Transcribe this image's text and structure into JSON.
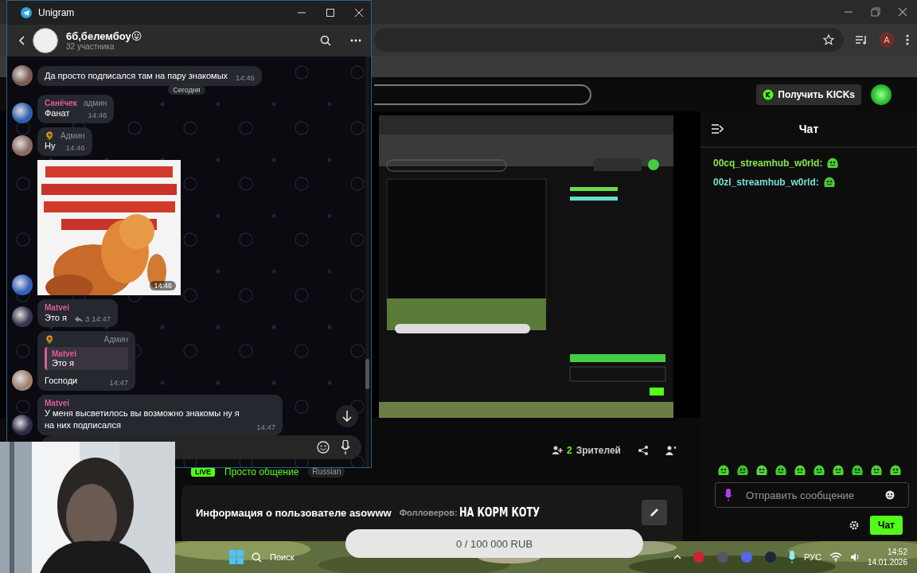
{
  "browser": {
    "profile_initial": "A"
  },
  "kick": {
    "get_kicks_button": "Получить KICKs",
    "viewers": {
      "count": "2",
      "label": "Зрителей"
    },
    "stream": {
      "live_badge": "LIVE",
      "category": "Просто общение",
      "language_tag": "Russian"
    },
    "info_card": {
      "title": "Информация о пользователе asowww",
      "followers_label": "Фолловеров:"
    },
    "chat": {
      "title": "Чат",
      "messages": [
        {
          "user": "00cq_streamhub_w0rld:",
          "color": "#86e84e"
        },
        {
          "user": "00zl_streamhub_w0rld:",
          "color": "#78e0d2"
        }
      ],
      "input": {
        "placeholder": "Отправить сообщение"
      },
      "send_button": "Чат"
    }
  },
  "overlay": {
    "goal_title": "НА КОРМ КОТУ",
    "goal": {
      "text": "0 / 100 000 RUB",
      "level": 0
    }
  },
  "telegram": {
    "window": {
      "title": "Unigram"
    },
    "chat": {
      "title": "6б,белембоу😛",
      "subtitle": "32 участника"
    },
    "date_chip": "Сегодня",
    "messages": [
      {
        "kind": "text",
        "text": "Да просто подписался там на пару знакомых",
        "time": "14:46"
      },
      {
        "kind": "text",
        "sender": "Санёчек",
        "role": "админ",
        "text": "Фанат",
        "time": "14:46"
      },
      {
        "kind": "text",
        "sender": "🌻",
        "role": "Админ",
        "text": "Ну",
        "time": "14:46"
      },
      {
        "kind": "sticker",
        "time": "14:46"
      },
      {
        "kind": "text",
        "sender": "Matvei",
        "text": "Это я",
        "replies": "3",
        "time": "14:47"
      },
      {
        "kind": "text",
        "sender": "🌻",
        "role": "Админ",
        "quote": {
          "sender": "Matvei",
          "text": "Это я"
        },
        "text": "Господи",
        "time": "14:47"
      },
      {
        "kind": "text",
        "sender": "Matvei",
        "text": "У меня высветилось вы возможно знакомы ну я на них подписался",
        "time": "14:47"
      }
    ]
  },
  "taskbar": {
    "search": "Поиск",
    "language": "РУС",
    "time": "14:52",
    "date": "14.01.2026"
  }
}
